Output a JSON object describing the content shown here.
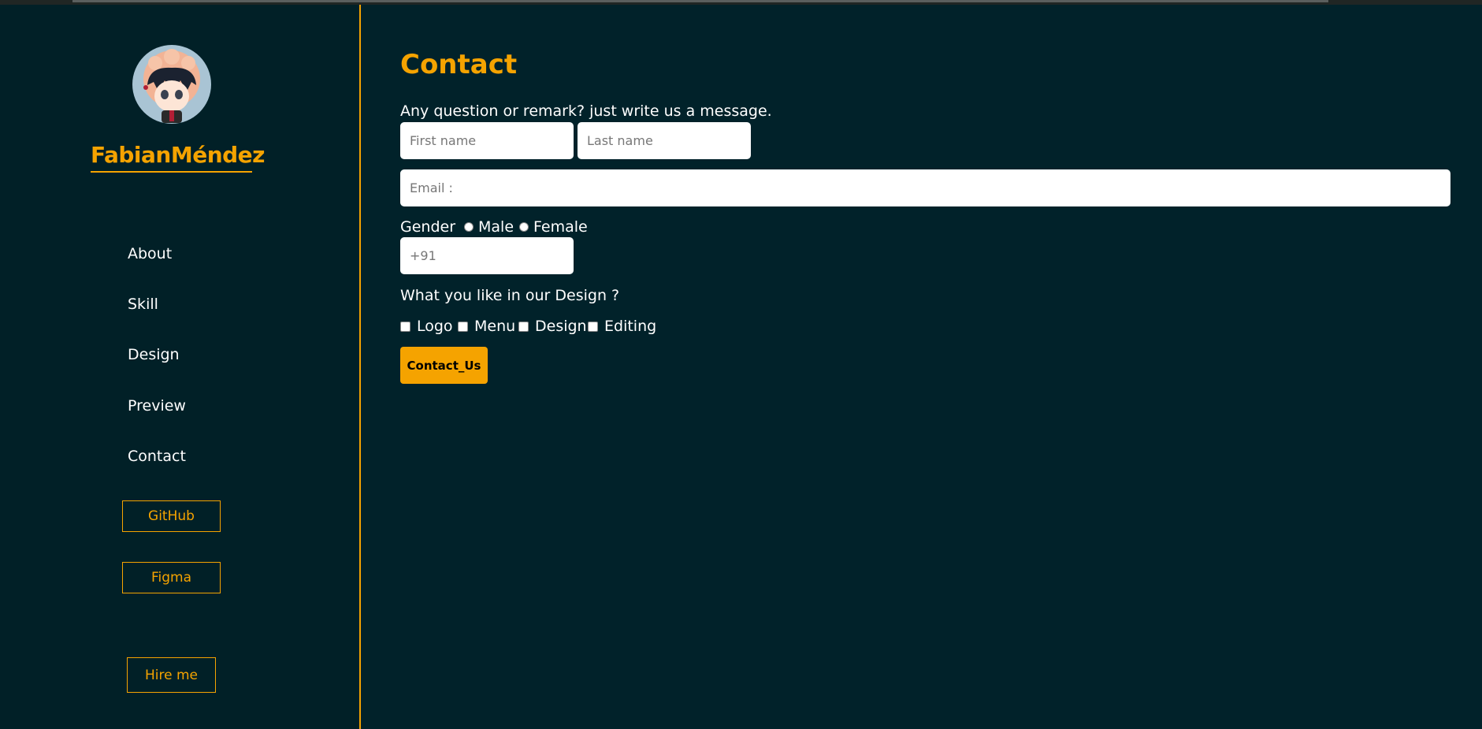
{
  "sidebar": {
    "brand": "FabianMéndez",
    "nav": [
      "About",
      "Skill",
      "Design",
      "Preview",
      "Contact"
    ],
    "buttons": {
      "github": "GitHub",
      "figma": "Figma",
      "hire": "Hire me"
    }
  },
  "contact": {
    "title": "Contact",
    "intro": "Any question or remark? just write us a message.",
    "first_name_placeholder": "First name",
    "last_name_placeholder": "Last name",
    "email_placeholder": "Email :",
    "gender_label": "Gender",
    "gender_options": [
      "Male",
      "Female"
    ],
    "phone_placeholder": "+91",
    "likes_question": "What you like in our Design ?",
    "likes_options": [
      "Logo",
      "Menu",
      "Design",
      "Editing"
    ],
    "submit_label": "Contact_Us"
  },
  "colors": {
    "accent": "#f5a300",
    "background": "#01222a"
  }
}
